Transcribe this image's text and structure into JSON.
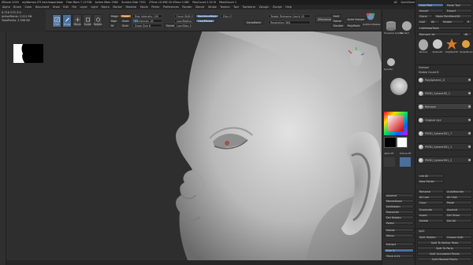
{
  "title_bar": {
    "app": "ZBrush 2020",
    "file": "myWoman.ZTl bercinaparlatan",
    "free_mem": "Free Mem 7.117GB",
    "active_mem": "Active Mem 2962",
    "scratch": "Scratch Disk 7351",
    "ztime": "ZTime 10.996 00 ATime 0.082",
    "poly_count": "PolyCount 2.52 M",
    "mesh_count": "MeshCount 1",
    "ac": "AC",
    "quicksave": "QuickSave",
    "see_through": "See-through 0",
    "menus": "Menus",
    "default_script": "DefaultZScript"
  },
  "menu_bar": [
    "Alpha",
    "Brush",
    "Color",
    "Document",
    "Draw",
    "Edit",
    "File",
    "Layer",
    "Light",
    "Macro",
    "Marker",
    "Material",
    "Movie",
    "Picker",
    "Preferences",
    "Render",
    "Stencil",
    "Stroke",
    "Texture",
    "Tool",
    "Transform",
    "Zplugin",
    "Zscript",
    "Help"
  ],
  "info": {
    "line1": "X:716 Y:72 Z:0",
    "active_points_label": "ActivePoints:",
    "active_points": "2.512 Mil",
    "total_points_label": "TotalPoints:",
    "total_points": "2.598 Mil"
  },
  "toolstrip": {
    "buttons": [
      {
        "label": "Edit",
        "active": true
      },
      {
        "label": "Draw",
        "active": true
      },
      {
        "label": "Move",
        "active": false
      },
      {
        "label": "Scale",
        "active": false
      },
      {
        "label": "Rotate",
        "active": false
      }
    ],
    "mrgb": "Mrgb",
    "rgb": "Rgb",
    "m": "M",
    "zadd": "Zadd",
    "zsub": "Zsub",
    "zcut": "Zcut",
    "rgb_intensity_label": "Rgb Intensity",
    "rgb_intensity": "100",
    "z_intensity_label": "Z Intensity",
    "z_intensity": "18",
    "draw_size_label": "Draw Size",
    "draw_size": "8",
    "dynamic": "Dynamic",
    "focal_label": "Focal Shift",
    "focal": "0",
    "focal2_label": "LazyRadius",
    "focal2": "20",
    "lazy_label": "LazyStep",
    "lazy": "0",
    "backface": "BackfaceMask",
    "lazy_mouse": "LazyMouse",
    "elev": "Elev",
    "elev_val": "0",
    "dynamesh": "DynaMesh",
    "target_poly_label": "Target Polygons Count",
    "target_poly": "20",
    "resolution_label": "Resolution",
    "resolution": "384",
    "zremesher": "ZRemesher",
    "half": "Half",
    "same": "Same",
    "double": "Double",
    "auto_groups": "Auto Groups",
    "subtool_master": "SubTool Master",
    "polypaint": "PolyPaint",
    "zplugin": "ZPlugin"
  },
  "right_shelf": {
    "labels": [
      "Transpose Cylinder",
      "Standard",
      "Dynamic",
      "SimpleBrush",
      "Alpha Off",
      "Texture Off",
      "MatCap Gray"
    ],
    "buttons": [
      "Append",
      "MergeDown",
      "DelHidden",
      "ProjectAll",
      "Del Hidden",
      "Polish",
      "Divide",
      "Mirror",
      "Extract",
      "Sym X"
    ],
    "sym_label": "> X <",
    "sym_value": "Thick 0.02"
  },
  "right_panel": {
    "copy_tool": "Copy Tool",
    "paste_tool": "Paste Tool",
    "import": "Import",
    "export": "Export",
    "clone": "Clone",
    "make_polymesh": "Make PolyMesh3D",
    "goz": "GoZ",
    "all": "All",
    "visible": "Visible",
    "r": "R",
    "lightbox_tools": "Lightbox▸Tools",
    "tool_name": "Remove_Ist",
    "tool_count": "48",
    "thumbs": [
      "Remove",
      "Sphere3D",
      "PolyMesh3D",
      "SimpleBrush"
    ],
    "subtool_header": "Subtool",
    "visible_count": "Visible Count 8",
    "subtools": [
      {
        "name": "PolySphere1_0",
        "selected": false
      },
      {
        "name": "PM3D_Sphere3D_1",
        "selected": false
      },
      {
        "name": "Remove",
        "selected": true
      },
      {
        "name": "Original eye",
        "selected": false
      },
      {
        "name": "PM3D_Sphere3D1_7",
        "selected": false
      },
      {
        "name": "PM3D_Sphere3D1_1",
        "selected": false
      },
      {
        "name": "PM3D_Sphere3D1_2",
        "selected": false
      }
    ],
    "list_all": "List All",
    "new_folder": "New Folder",
    "rename": "Rename",
    "autoreorder": "AutoReorder",
    "all_low": "All Low",
    "all_high": "All High",
    "copy": "Copy",
    "paste": "Paste",
    "duplicate": "Duplicate",
    "append": "Append",
    "insert": "Insert",
    "del_other": "Del Other",
    "delete": "Delete",
    "del_all": "Del All",
    "split": "Split",
    "split_hidden": "Split Hidden",
    "groups_split": "Groups Split",
    "split_similar": "Split To Similar Parts",
    "split_parts": "Split To Parts",
    "split_unmasked": "Split Unmasked Points",
    "split_masked": "Split Masked Points",
    "merge": "Merge"
  },
  "colors": {
    "accent_blue": "#4b6f9c",
    "orange": "#c9791f",
    "panel": "#2c2c2c",
    "viewport": "#2e2e2e"
  }
}
